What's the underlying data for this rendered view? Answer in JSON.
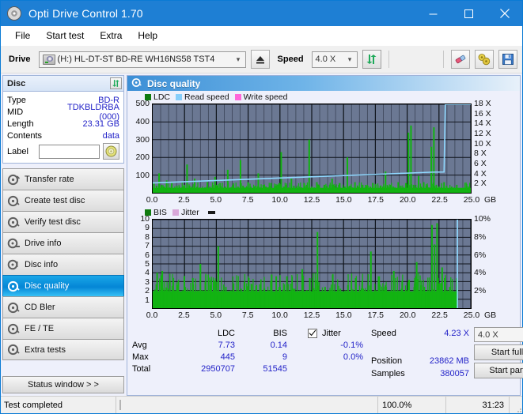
{
  "window": {
    "title": "Opti Drive Control 1.70",
    "icon": "disc-icon",
    "minimize": "minimize",
    "maximize": "maximize",
    "close": "close"
  },
  "menu": [
    "File",
    "Start test",
    "Extra",
    "Help"
  ],
  "toolbar": {
    "drive_label": "Drive",
    "drive_value": "(H:)  HL-DT-ST BD-RE  WH16NS58 TST4",
    "eject_icon": "eject-icon",
    "speed_label": "Speed",
    "speed_value": "4.0 X",
    "refresh_icon": "refresh-icon",
    "erase_icon": "eraser-icon",
    "tools_icon": "cymbals-icon",
    "save_icon": "save-icon"
  },
  "disc_panel": {
    "title": "Disc",
    "refresh_icon": "refresh-icon",
    "rows": [
      {
        "key": "Type",
        "value": "BD-R"
      },
      {
        "key": "MID",
        "value": "TDKBLDRBA (000)"
      },
      {
        "key": "Length",
        "value": "23.31 GB"
      },
      {
        "key": "Contents",
        "value": "data"
      }
    ],
    "label_key": "Label",
    "label_value": "",
    "label_button_icon": "disc-icon"
  },
  "sidebar": {
    "items": [
      {
        "label": "Transfer rate",
        "active": false
      },
      {
        "label": "Create test disc",
        "active": false
      },
      {
        "label": "Verify test disc",
        "active": false
      },
      {
        "label": "Drive info",
        "active": false
      },
      {
        "label": "Disc info",
        "active": false
      },
      {
        "label": "Disc quality",
        "active": true
      },
      {
        "label": "CD Bler",
        "active": false
      },
      {
        "label": "FE / TE",
        "active": false
      },
      {
        "label": "Extra tests",
        "active": false
      }
    ],
    "status_window": "Status window > >"
  },
  "main": {
    "title": "Disc quality",
    "icon": "disc-quality-icon"
  },
  "chart_data": [
    {
      "type": "bar",
      "name": "ldc-chart",
      "title": "",
      "legend": [
        {
          "label": "LDC",
          "color": "#0f7a0f"
        },
        {
          "label": "Read speed",
          "color": "#87cefa"
        },
        {
          "label": "Write speed",
          "color": "#ff66d9"
        }
      ],
      "xlabel": "GB",
      "x_ticks": [
        "0.0",
        "2.5",
        "5.0",
        "7.5",
        "10.0",
        "12.5",
        "15.0",
        "17.5",
        "20.0",
        "22.5",
        "25.0"
      ],
      "xlim": [
        0,
        25
      ],
      "ylabel_left": "",
      "y_ticks_left": [
        "100",
        "200",
        "300",
        "400",
        "500"
      ],
      "ylim_left": [
        0,
        500
      ],
      "ylabel_right": "",
      "y_ticks_right": [
        "2 X",
        "4 X",
        "6 X",
        "8 X",
        "10 X",
        "12 X",
        "14 X",
        "16 X",
        "18 X"
      ],
      "ylim_right": [
        0,
        18
      ],
      "grid": true,
      "plot_bg": "#6b7893",
      "series": [
        {
          "name": "LDC",
          "color": "#12b312",
          "x": [
            0.1,
            0.3,
            0.5,
            0.7,
            0.9,
            1.1,
            1.3,
            1.5,
            1.7,
            1.9,
            2.1,
            2.3,
            2.5,
            2.7,
            2.9,
            3.1,
            3.3,
            3.5,
            3.7,
            3.9,
            4.1,
            4.3,
            4.5,
            4.7,
            4.9,
            5.1,
            5.3,
            5.5,
            5.7,
            5.9,
            6.1,
            6.3,
            6.5,
            6.7,
            6.9,
            7.1,
            7.3,
            7.5,
            7.7,
            7.9,
            8.1,
            8.3,
            8.5,
            8.7,
            8.9,
            9.1,
            9.3,
            9.5,
            9.7,
            9.9,
            10.1,
            10.3,
            10.5,
            10.7,
            10.9,
            11.1,
            11.3,
            11.5,
            11.7,
            11.9,
            12.1,
            12.3,
            12.5,
            12.7,
            12.9,
            13.1,
            13.3,
            13.5,
            13.7,
            13.9,
            14.1,
            14.3,
            14.5,
            14.7,
            14.9,
            15.1,
            15.3,
            15.5,
            15.7,
            15.9,
            16.1,
            16.3,
            16.5,
            16.7,
            16.9,
            17.1,
            17.3,
            17.5,
            17.7,
            17.9,
            18.1,
            18.3,
            18.5,
            18.7,
            18.9,
            19.1,
            19.3,
            19.5,
            19.7,
            19.9,
            20.1,
            20.3,
            20.5,
            20.7,
            20.9,
            21.1,
            21.3,
            21.5,
            21.7,
            21.9,
            22.1,
            22.3,
            22.5,
            22.7,
            22.9,
            23.1,
            23.3,
            23.5,
            23.7,
            23.9
          ],
          "values": [
            60,
            40,
            110,
            45,
            35,
            70,
            30,
            55,
            25,
            40,
            35,
            30,
            45,
            160,
            40,
            30,
            80,
            35,
            30,
            25,
            30,
            60,
            35,
            30,
            90,
            40,
            55,
            30,
            35,
            130,
            30,
            45,
            25,
            35,
            185,
            40,
            30,
            60,
            35,
            25,
            40,
            110,
            30,
            45,
            35,
            30,
            55,
            25,
            40,
            30,
            230,
            35,
            45,
            30,
            80,
            40,
            25,
            35,
            30,
            55,
            45,
            300,
            35,
            30,
            60,
            40,
            25,
            45,
            35,
            30,
            80,
            40,
            30,
            55,
            25,
            35,
            200,
            40,
            30,
            60,
            35,
            25,
            45,
            30,
            40,
            35,
            55,
            30,
            25,
            40,
            35,
            120,
            30,
            45,
            35,
            25,
            60,
            40,
            30,
            55,
            340,
            380,
            45,
            30,
            95,
            35,
            60,
            40,
            30,
            260,
            370,
            45,
            35,
            30,
            60,
            40,
            25,
            35,
            30,
            45
          ]
        },
        {
          "name": "Read speed",
          "color": "#8fd8ff",
          "x": [
            0,
            1,
            2,
            3,
            4,
            5,
            6,
            7,
            8,
            9,
            10,
            11,
            12,
            13,
            14,
            15,
            16,
            17,
            18,
            19,
            20,
            21,
            22,
            22.9,
            23.0,
            23.1,
            25
          ],
          "values": [
            2.0,
            2.1,
            2.2,
            2.3,
            2.4,
            2.5,
            2.6,
            2.7,
            2.8,
            2.9,
            3.0,
            3.1,
            3.2,
            3.3,
            3.4,
            3.5,
            3.6,
            3.7,
            3.8,
            3.9,
            4.0,
            4.1,
            4.2,
            4.23,
            18,
            18,
            18
          ]
        }
      ]
    },
    {
      "type": "bar",
      "name": "bis-chart",
      "title": "",
      "legend": [
        {
          "label": "BIS",
          "color": "#0f7a0f"
        },
        {
          "label": "Jitter",
          "color": "#d9a8d9"
        }
      ],
      "xlabel": "GB",
      "x_ticks": [
        "0.0",
        "2.5",
        "5.0",
        "7.5",
        "10.0",
        "12.5",
        "15.0",
        "17.5",
        "20.0",
        "22.5",
        "25.0"
      ],
      "xlim": [
        0,
        25
      ],
      "y_ticks_left": [
        "1",
        "2",
        "3",
        "4",
        "5",
        "6",
        "7",
        "8",
        "9",
        "10"
      ],
      "ylim_left": [
        0,
        10
      ],
      "y_ticks_right": [
        "2%",
        "4%",
        "6%",
        "8%",
        "10%"
      ],
      "ylim_right": [
        0,
        10
      ],
      "grid": true,
      "plot_bg": "#6b7893",
      "series": [
        {
          "name": "BIS",
          "color": "#12b312",
          "x": [
            0.15,
            0.35,
            0.55,
            0.75,
            0.95,
            1.15,
            1.35,
            1.55,
            1.75,
            1.95,
            2.15,
            2.35,
            2.55,
            2.75,
            2.95,
            3.15,
            3.35,
            3.55,
            3.75,
            3.95,
            4.15,
            4.35,
            4.55,
            4.75,
            4.95,
            5.15,
            5.35,
            5.55,
            5.75,
            5.95,
            6.15,
            6.35,
            6.55,
            6.75,
            6.95,
            7.15,
            7.35,
            7.55,
            7.75,
            7.95,
            8.15,
            8.35,
            8.55,
            8.75,
            8.95,
            9.15,
            9.35,
            9.55,
            9.75,
            9.95,
            10.15,
            10.35,
            10.55,
            10.75,
            10.95,
            11.15,
            11.35,
            11.55,
            11.75,
            11.95,
            12.15,
            12.35,
            12.55,
            12.75,
            12.95,
            13.15,
            13.35,
            13.55,
            13.75,
            13.95,
            14.15,
            14.35,
            14.55,
            14.75,
            14.95,
            15.15,
            15.35,
            15.55,
            15.75,
            15.95,
            16.15,
            16.35,
            16.55,
            16.75,
            16.95,
            17.15,
            17.35,
            17.55,
            17.75,
            17.95,
            18.15,
            18.35,
            18.55,
            18.75,
            18.95,
            19.15,
            19.35,
            19.55,
            19.75,
            19.95,
            20.15,
            20.35,
            20.55,
            20.75,
            20.95,
            21.15,
            21.35,
            21.55,
            21.75,
            21.95,
            22.15,
            22.35,
            22.55,
            22.75,
            22.95,
            23.15,
            23.35,
            23.55,
            23.75,
            23.95
          ],
          "values": [
            2,
            4,
            1.8,
            4.2,
            2,
            1.6,
            3,
            1.8,
            2,
            2.6,
            1.8,
            2,
            2.4,
            1.6,
            2,
            3.4,
            1.6,
            2,
            5,
            2,
            1.8,
            2,
            2.6,
            1.8,
            2,
            7,
            1.8,
            2,
            2.4,
            1.6,
            2,
            2.8,
            1.6,
            2,
            2.2,
            1.8,
            2,
            3.4,
            1.6,
            2,
            2.6,
            1.8,
            2,
            2.2,
            1.6,
            2,
            3.8,
            1.6,
            2,
            2.4,
            1.8,
            2,
            3.6,
            1.6,
            2,
            2.2,
            1.8,
            2,
            4.4,
            1.6,
            2,
            3.4,
            1.8,
            2,
            8.6,
            1.6,
            2,
            2.4,
            1.8,
            2,
            3.8,
            1.6,
            2,
            2.2,
            1.8,
            2,
            2.6,
            1.6,
            2,
            3.4,
            1.8,
            2,
            2.2,
            1.6,
            2,
            6.4,
            1.8,
            2,
            3.6,
            1.6,
            2,
            2.4,
            1.8,
            2,
            4.2,
            1.6,
            2,
            2.2,
            1.8,
            2,
            3.2,
            1.6,
            2,
            5.2,
            1.8,
            2,
            2.4,
            1.6,
            2,
            9.4,
            7.2,
            9.6,
            2.8,
            4.6,
            3.4,
            2,
            2.4,
            1.8
          ]
        }
      ]
    }
  ],
  "stats": {
    "headers": {
      "ldc": "LDC",
      "bis": "BIS"
    },
    "rows": [
      {
        "key": "Avg",
        "ldc": "7.73",
        "bis": "0.14"
      },
      {
        "key": "Max",
        "ldc": "445",
        "bis": "9"
      },
      {
        "key": "Total",
        "ldc": "2950707",
        "bis": "51545"
      }
    ],
    "jitter_label": "Jitter",
    "jitter_checked": true,
    "jitter_avg": "-0.1%",
    "jitter_max": "0.0%"
  },
  "right_panel": {
    "speed_key": "Speed",
    "speed_value": "4.23 X",
    "position_key": "Position",
    "position_value": "23862 MB",
    "samples_key": "Samples",
    "samples_value": "380057",
    "speed_select": "4.0 X",
    "start_full": "Start full",
    "start_part": "Start part"
  },
  "statusbar": {
    "message": "Test completed",
    "progress_percent": 100.0,
    "progress_text": "100.0%",
    "elapsed": "31:23"
  }
}
